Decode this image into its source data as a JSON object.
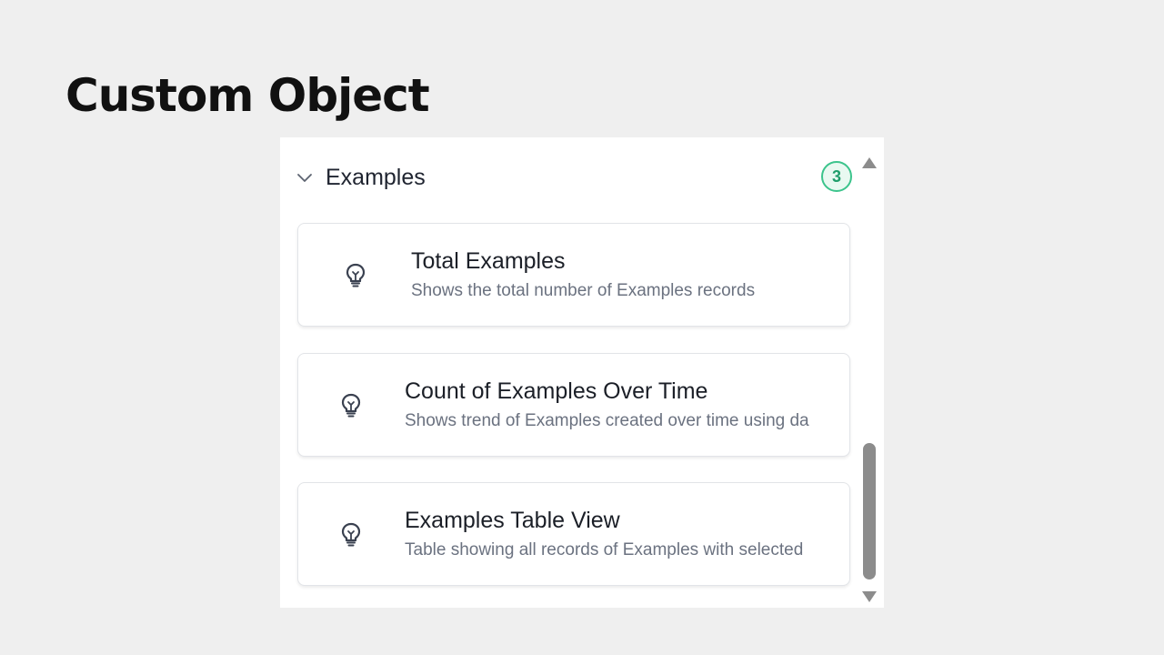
{
  "page": {
    "title": "Custom Object"
  },
  "section": {
    "title": "Examples",
    "count": "3",
    "expanded": true,
    "toggle_icon": "chevron-down-icon",
    "badge_color": "#3cc48c"
  },
  "cards": [
    {
      "icon": "lightbulb-icon",
      "title": "Total Examples",
      "description": "Shows the total number of Examples records"
    },
    {
      "icon": "lightbulb-icon",
      "title": "Count of Examples Over Time",
      "description": "Shows trend of Examples created over time using da"
    },
    {
      "icon": "lightbulb-icon",
      "title": "Examples Table View",
      "description": "Table showing all records of Examples with selected"
    }
  ],
  "scrollbar": {
    "up_icon": "triangle-up-icon",
    "down_icon": "triangle-down-icon",
    "position": 0.9
  }
}
